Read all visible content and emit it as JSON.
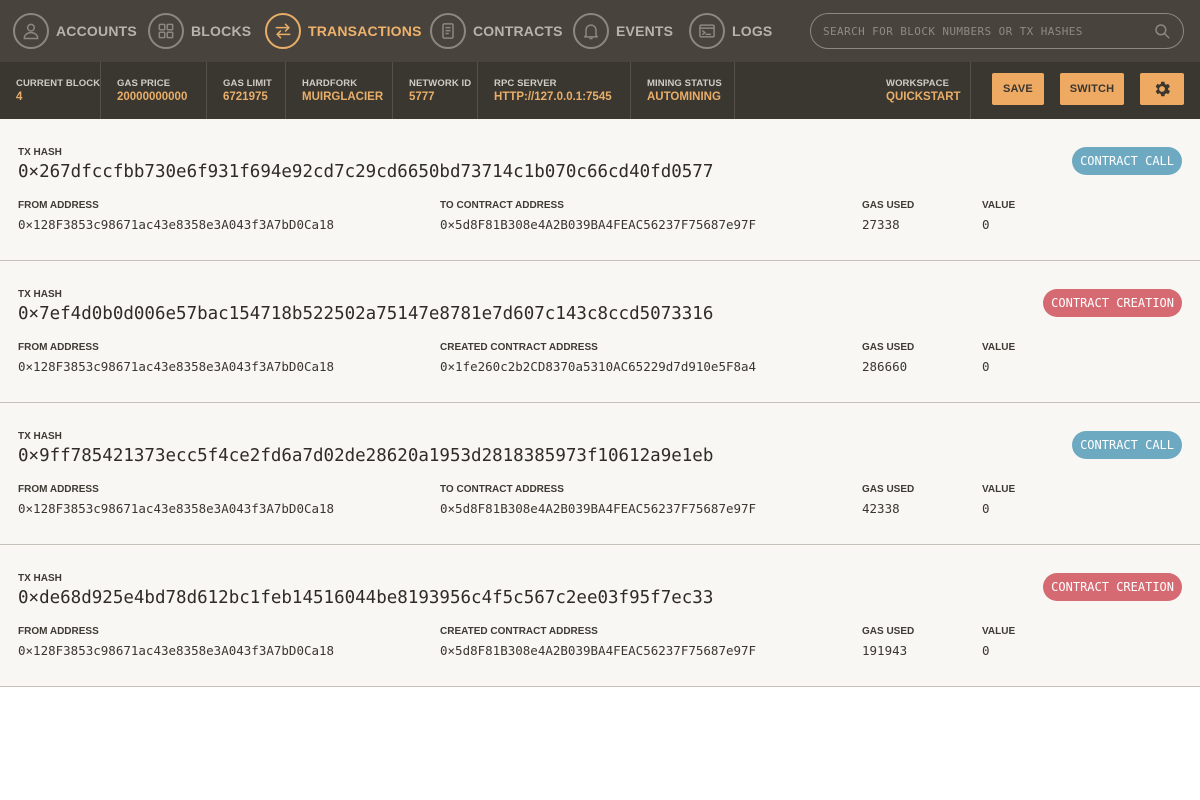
{
  "nav": {
    "items": [
      {
        "label": "ACCOUNTS",
        "icon": "account-icon"
      },
      {
        "label": "BLOCKS",
        "icon": "blocks-icon"
      },
      {
        "label": "TRANSACTIONS",
        "icon": "transactions-icon"
      },
      {
        "label": "CONTRACTS",
        "icon": "contracts-icon"
      },
      {
        "label": "EVENTS",
        "icon": "bell-icon"
      },
      {
        "label": "LOGS",
        "icon": "terminal-icon"
      }
    ],
    "active": "TRANSACTIONS",
    "search_placeholder": "SEARCH FOR BLOCK NUMBERS OR TX HASHES"
  },
  "status": {
    "current_block": {
      "label": "CURRENT BLOCK",
      "value": "4"
    },
    "gas_price": {
      "label": "GAS PRICE",
      "value": "20000000000"
    },
    "gas_limit": {
      "label": "GAS LIMIT",
      "value": "6721975"
    },
    "hardfork": {
      "label": "HARDFORK",
      "value": "MUIRGLACIER"
    },
    "network_id": {
      "label": "NETWORK ID",
      "value": "5777"
    },
    "rpc_server": {
      "label": "RPC SERVER",
      "value": "HTTP://127.0.0.1:7545"
    },
    "mining_status": {
      "label": "MINING STATUS",
      "value": "AUTOMINING"
    },
    "workspace": {
      "label": "WORKSPACE",
      "value": "QUICKSTART"
    }
  },
  "buttons": {
    "save": "SAVE",
    "switch": "SWITCH"
  },
  "colors": {
    "nav_bg": "#48443d",
    "status_bg": "#3a3630",
    "accent": "#e8ae69",
    "badge_call": "#6ea9c2",
    "badge_creation": "#d56a72"
  },
  "transactions": [
    {
      "hash_label": "TX HASH",
      "hash": "0×267dfccfbb730e6f931f694e92cd7c29cd6650bd73714c1b070c66cd40fd0577",
      "type": "CONTRACT CALL",
      "from_label": "FROM ADDRESS",
      "from": "0×128F3853c98671ac43e8358e3A043f3A7bD0Ca18",
      "to_label": "TO CONTRACT ADDRESS",
      "to": "0×5d8F81B308e4A2B039BA4FEAC56237F75687e97F",
      "gas_label": "GAS USED",
      "gas": "27338",
      "value_label": "VALUE",
      "value": "0"
    },
    {
      "hash_label": "TX HASH",
      "hash": "0×7ef4d0b0d006e57bac154718b522502a75147e8781e7d607c143c8ccd5073316",
      "type": "CONTRACT CREATION",
      "from_label": "FROM ADDRESS",
      "from": "0×128F3853c98671ac43e8358e3A043f3A7bD0Ca18",
      "to_label": "CREATED CONTRACT ADDRESS",
      "to": "0×1fe260c2b2CD8370a5310AC65229d7d910e5F8a4",
      "gas_label": "GAS USED",
      "gas": "286660",
      "value_label": "VALUE",
      "value": "0"
    },
    {
      "hash_label": "TX HASH",
      "hash": "0×9ff785421373ecc5f4ce2fd6a7d02de28620a1953d2818385973f10612a9e1eb",
      "type": "CONTRACT CALL",
      "from_label": "FROM ADDRESS",
      "from": "0×128F3853c98671ac43e8358e3A043f3A7bD0Ca18",
      "to_label": "TO CONTRACT ADDRESS",
      "to": "0×5d8F81B308e4A2B039BA4FEAC56237F75687e97F",
      "gas_label": "GAS USED",
      "gas": "42338",
      "value_label": "VALUE",
      "value": "0"
    },
    {
      "hash_label": "TX HASH",
      "hash": "0×de68d925e4bd78d612bc1feb14516044be8193956c4f5c567c2ee03f95f7ec33",
      "type": "CONTRACT CREATION",
      "from_label": "FROM ADDRESS",
      "from": "0×128F3853c98671ac43e8358e3A043f3A7bD0Ca18",
      "to_label": "CREATED CONTRACT ADDRESS",
      "to": "0×5d8F81B308e4A2B039BA4FEAC56237F75687e97F",
      "gas_label": "GAS USED",
      "gas": "191943",
      "value_label": "VALUE",
      "value": "0"
    }
  ]
}
